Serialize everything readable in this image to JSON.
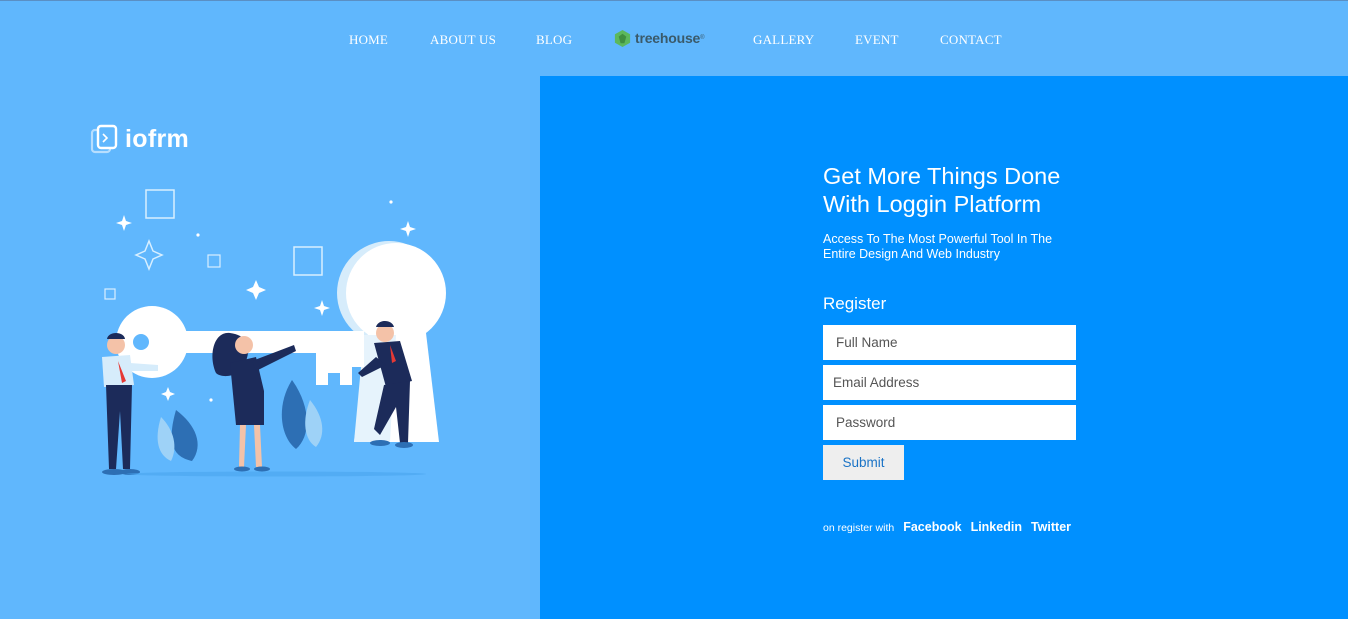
{
  "nav": {
    "items": [
      "HOME",
      "ABOUT US",
      "BLOG",
      "GALLERY",
      "EVENT",
      "CONTACT"
    ],
    "logo_text": "treehouse"
  },
  "brand": {
    "name": "iofrm"
  },
  "hero": {
    "headline_line1": "Get More Things Done",
    "headline_line2": "With Loggin Platform",
    "subline": "Access To The Most Powerful Tool In The Entire Design And Web Industry"
  },
  "form": {
    "title": "Register",
    "full_name_placeholder": "Full Name",
    "email_placeholder": "Email Address",
    "password_placeholder": "Password",
    "submit_label": "Submit"
  },
  "social": {
    "prefix": "on register with",
    "links": [
      "Facebook",
      "Linkedin",
      "Twitter"
    ]
  },
  "colors": {
    "page_bg": "#60b7fd",
    "panel_bg": "#0090ff",
    "submit_text": "#1a73c6"
  }
}
